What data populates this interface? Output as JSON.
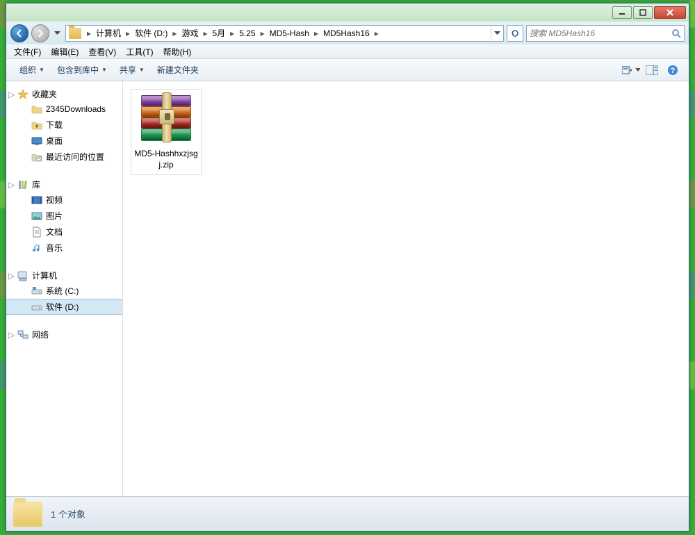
{
  "breadcrumb": {
    "parts": [
      "计算机",
      "软件 (D:)",
      "游戏",
      "5月",
      "5.25",
      "MD5-Hash",
      "MD5Hash16"
    ]
  },
  "search": {
    "placeholder": "搜索 MD5Hash16"
  },
  "menubar": {
    "file": "文件(F)",
    "edit": "编辑(E)",
    "view": "查看(V)",
    "tools": "工具(T)",
    "help": "帮助(H)"
  },
  "toolbar": {
    "organize": "组织",
    "include": "包含到库中",
    "share": "共享",
    "newfolder": "新建文件夹"
  },
  "sidebar": {
    "favorites": {
      "label": "收藏夹",
      "items": [
        "2345Downloads",
        "下载",
        "桌面",
        "最近访问的位置"
      ]
    },
    "libraries": {
      "label": "库",
      "items": [
        "视频",
        "图片",
        "文档",
        "音乐"
      ]
    },
    "computer": {
      "label": "计算机",
      "items": [
        "系统 (C:)",
        "软件 (D:)"
      ]
    },
    "network": {
      "label": "网络"
    }
  },
  "files": [
    {
      "name": "MD5-Hashhxzjsgj.zip"
    }
  ],
  "status": {
    "text": "1 个对象"
  }
}
